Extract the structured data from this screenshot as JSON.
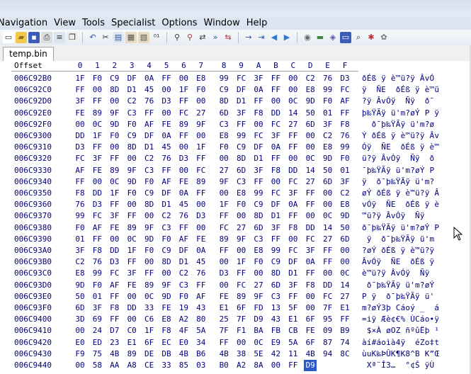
{
  "menu": [
    "Navigation",
    "View",
    "Tools",
    "Specialist",
    "Options",
    "Window",
    "Help"
  ],
  "toolbar_icons": [
    "new-file-icon",
    "open-folder-icon",
    "save-icon",
    "print-icon",
    "properties-icon",
    "copy-icon",
    "sep",
    "undo-icon",
    "cut-icon",
    "copy-block-icon",
    "paste-icon",
    "paste-write-icon",
    "hex-values-icon",
    "sep",
    "find-icon",
    "find-hex-icon",
    "replace-icon",
    "find-next-icon",
    "replace-hex-icon",
    "sep",
    "goto-offset-icon",
    "goto-sector-icon",
    "back-arrow-icon",
    "forward-arrow-icon",
    "sep",
    "disk-tools-icon",
    "ram-icon",
    "image-icon",
    "drive-icon",
    "search-disk-icon",
    "settings-icon",
    "options-icon"
  ],
  "tab": {
    "label": "temp.bin"
  },
  "header": {
    "offset_label": "Offset",
    "columns": [
      "0",
      "1",
      "2",
      "3",
      "4",
      "5",
      "6",
      "7",
      "8",
      "9",
      "A",
      "B",
      "C",
      "D",
      "E",
      "F"
    ]
  },
  "rows": [
    {
      "offset": "006C92B0",
      "hex": [
        "1F",
        "F0",
        "C9",
        "DF",
        "0A",
        "FF",
        "00",
        "E8",
        "99",
        "FC",
        "3F",
        "FF",
        "00",
        "C2",
        "76",
        "D3"
      ],
      "ascii": "ðÉß ÿ è™ü?ÿ ÂvÓ"
    },
    {
      "offset": "006C92C0",
      "hex": [
        "FF",
        "00",
        "8D",
        "D1",
        "45",
        "00",
        "1F",
        "F0",
        "C9",
        "DF",
        "0A",
        "FF",
        "00",
        "E8",
        "99",
        "FC"
      ],
      "ascii": "ÿ  ÑE  ðÉß ÿ è™ü"
    },
    {
      "offset": "006C92D0",
      "hex": [
        "3F",
        "FF",
        "00",
        "C2",
        "76",
        "D3",
        "FF",
        "00",
        "8D",
        "D1",
        "FF",
        "00",
        "0C",
        "9D",
        "F0",
        "AF"
      ],
      "ascii": "?ÿ ÂvÓÿ  Ñÿ  ð¯"
    },
    {
      "offset": "006C92E0",
      "hex": [
        "FE",
        "89",
        "9F",
        "C3",
        "FF",
        "00",
        "FC",
        "27",
        "6D",
        "3F",
        "F8",
        "DD",
        "14",
        "50",
        "01",
        "FF"
      ],
      "ascii": "þ‰ŸÃÿ ü'm?øÝ P ÿ"
    },
    {
      "offset": "006C92F0",
      "hex": [
        "00",
        "0C",
        "9D",
        "F0",
        "AF",
        "FE",
        "89",
        "9F",
        "C3",
        "FF",
        "00",
        "FC",
        "27",
        "6D",
        "3F",
        "F8"
      ],
      "ascii": "  ð¯þ‰ŸÃÿ ü'm?ø"
    },
    {
      "offset": "006C9300",
      "hex": [
        "DD",
        "1F",
        "F0",
        "C9",
        "DF",
        "0A",
        "FF",
        "00",
        "E8",
        "99",
        "FC",
        "3F",
        "FF",
        "00",
        "C2",
        "76"
      ],
      "ascii": "Ý ðÉß ÿ è™ü?ÿ Âv"
    },
    {
      "offset": "006C9310",
      "hex": [
        "D3",
        "FF",
        "00",
        "8D",
        "D1",
        "45",
        "00",
        "1F",
        "F0",
        "C9",
        "DF",
        "0A",
        "FF",
        "00",
        "E8",
        "99"
      ],
      "ascii": "Óÿ  ÑE  ðÉß ÿ è™"
    },
    {
      "offset": "006C9320",
      "hex": [
        "FC",
        "3F",
        "FF",
        "00",
        "C2",
        "76",
        "D3",
        "FF",
        "00",
        "8D",
        "D1",
        "FF",
        "00",
        "0C",
        "9D",
        "F0"
      ],
      "ascii": "ü?ÿ ÂvÓÿ  Ñÿ  ð"
    },
    {
      "offset": "006C9330",
      "hex": [
        "AF",
        "FE",
        "89",
        "9F",
        "C3",
        "FF",
        "00",
        "FC",
        "27",
        "6D",
        "3F",
        "F8",
        "DD",
        "14",
        "50",
        "01"
      ],
      "ascii": "¯þ‰ŸÃÿ ü'm?øÝ P "
    },
    {
      "offset": "006C9340",
      "hex": [
        "FF",
        "00",
        "0C",
        "9D",
        "F0",
        "AF",
        "FE",
        "89",
        "9F",
        "C3",
        "FF",
        "00",
        "FC",
        "27",
        "6D",
        "3F"
      ],
      "ascii": "ÿ  ð¯þ‰ŸÃÿ ü'm?"
    },
    {
      "offset": "006C9350",
      "hex": [
        "F8",
        "DD",
        "1F",
        "F0",
        "C9",
        "DF",
        "0A",
        "FF",
        "00",
        "E8",
        "99",
        "FC",
        "3F",
        "FF",
        "00",
        "C2"
      ],
      "ascii": "øÝ ðÉß ÿ è™ü?ÿ Â"
    },
    {
      "offset": "006C9360",
      "hex": [
        "76",
        "D3",
        "FF",
        "00",
        "8D",
        "D1",
        "45",
        "00",
        "1F",
        "F0",
        "C9",
        "DF",
        "0A",
        "FF",
        "00",
        "E8"
      ],
      "ascii": "vÓÿ  ÑE  ðÉß ÿ è"
    },
    {
      "offset": "006C9370",
      "hex": [
        "99",
        "FC",
        "3F",
        "FF",
        "00",
        "C2",
        "76",
        "D3",
        "FF",
        "00",
        "8D",
        "D1",
        "FF",
        "00",
        "0C",
        "9D"
      ],
      "ascii": "™ü?ÿ ÂvÓÿ  Ñÿ  "
    },
    {
      "offset": "006C9380",
      "hex": [
        "F0",
        "AF",
        "FE",
        "89",
        "9F",
        "C3",
        "FF",
        "00",
        "FC",
        "27",
        "6D",
        "3F",
        "F8",
        "DD",
        "14",
        "50"
      ],
      "ascii": "ð¯þ‰ŸÃÿ ü'm?øÝ P"
    },
    {
      "offset": "006C9390",
      "hex": [
        "01",
        "FF",
        "00",
        "0C",
        "9D",
        "F0",
        "AF",
        "FE",
        "89",
        "9F",
        "C3",
        "FF",
        "00",
        "FC",
        "27",
        "6D"
      ],
      "ascii": " ÿ  ð¯þ‰ŸÃÿ ü'm"
    },
    {
      "offset": "006C93A0",
      "hex": [
        "3F",
        "F8",
        "DD",
        "1F",
        "F0",
        "C9",
        "DF",
        "0A",
        "FF",
        "00",
        "E8",
        "99",
        "FC",
        "3F",
        "FF",
        "00"
      ],
      "ascii": "?øÝ ðÉß ÿ è™ü?ÿ "
    },
    {
      "offset": "006C93B0",
      "hex": [
        "C2",
        "76",
        "D3",
        "FF",
        "00",
        "8D",
        "D1",
        "45",
        "00",
        "1F",
        "F0",
        "C9",
        "DF",
        "0A",
        "FF",
        "00"
      ],
      "ascii": "ÂvÓÿ  ÑE  ðÉß ÿ "
    },
    {
      "offset": "006C93C0",
      "hex": [
        "E8",
        "99",
        "FC",
        "3F",
        "FF",
        "00",
        "C2",
        "76",
        "D3",
        "FF",
        "00",
        "8D",
        "D1",
        "FF",
        "00",
        "0C"
      ],
      "ascii": "è™ü?ÿ ÂvÓÿ  Ñÿ  "
    },
    {
      "offset": "006C93D0",
      "hex": [
        "9D",
        "F0",
        "AF",
        "FE",
        "89",
        "9F",
        "C3",
        "FF",
        "00",
        "FC",
        "27",
        "6D",
        "3F",
        "F8",
        "DD",
        "14"
      ],
      "ascii": " ð¯þ‰ŸÃÿ ü'm?øÝ "
    },
    {
      "offset": "006C93E0",
      "hex": [
        "50",
        "01",
        "FF",
        "00",
        "0C",
        "9D",
        "F0",
        "AF",
        "FE",
        "89",
        "9F",
        "C3",
        "FF",
        "00",
        "FC",
        "27"
      ],
      "ascii": "P ÿ  ð¯þ‰ŸÃÿ ü'"
    },
    {
      "offset": "006C93F0",
      "hex": [
        "6D",
        "3F",
        "F8",
        "DD",
        "33",
        "FE",
        "19",
        "43",
        "E1",
        "6F",
        "FD",
        "13",
        "5F",
        "00",
        "7F",
        "E1"
      ],
      "ascii": "m?øÝ3þ Cáoý _  á"
    },
    {
      "offset": "006C9400",
      "hex": [
        "3D",
        "69",
        "FF",
        "00",
        "C6",
        "E8",
        "A2",
        "80",
        "25",
        "7F",
        "D9",
        "43",
        "E1",
        "6F",
        "95",
        "FF"
      ],
      "ascii": "=iÿ Æè¢€% ÙCáo•ÿ"
    },
    {
      "offset": "006C9410",
      "hex": [
        "00",
        "24",
        "D7",
        "C0",
        "1F",
        "F8",
        "4F",
        "5A",
        "7F",
        "F1",
        "BA",
        "FB",
        "CB",
        "FE",
        "09",
        "B9"
      ],
      "ascii": " $×À øOZ ñºûËþ ¹"
    },
    {
      "offset": "006C9420",
      "hex": [
        "E0",
        "ED",
        "23",
        "E1",
        "6F",
        "EC",
        "E0",
        "34",
        "FF",
        "00",
        "0C",
        "E9",
        "5A",
        "6F",
        "87",
        "74"
      ],
      "ascii": "àí#áoìà4ÿ  éZo‡t"
    },
    {
      "offset": "006C9430",
      "hex": [
        "F9",
        "75",
        "4B",
        "89",
        "DE",
        "DB",
        "4B",
        "B6",
        "4B",
        "38",
        "5E",
        "42",
        "11",
        "4B",
        "94",
        "8C"
      ],
      "ascii": "ùuK‰ÞÛK¶K8^B K”Œ"
    },
    {
      "offset": "006C9440",
      "hex": [
        "00",
        "58",
        "AA",
        "A8",
        "CE",
        "33",
        "85",
        "03",
        "B0",
        "A2",
        "8A",
        "00",
        "FF",
        "D9",
        "",
        ""
      ],
      "ascii": " Xª¨Î3…  °¢Š ÿÙ"
    }
  ],
  "selected": {
    "row": 25,
    "col": 13
  }
}
